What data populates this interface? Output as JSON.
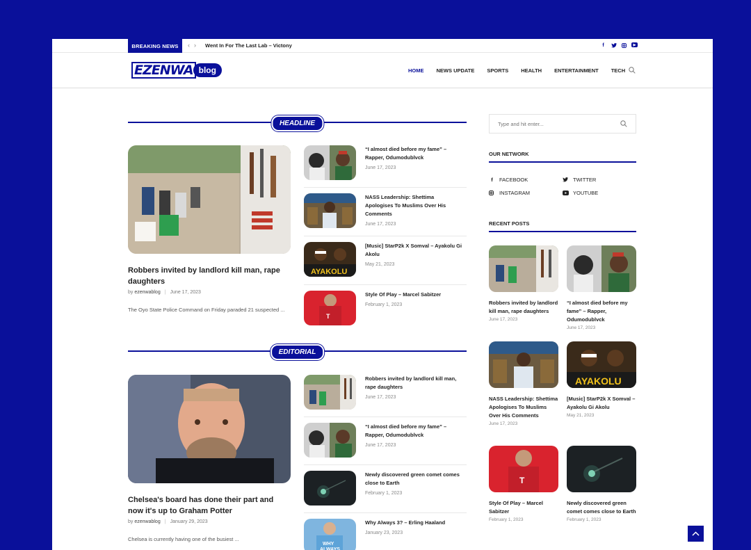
{
  "topbar": {
    "breaking_label": "BREAKING NEWS",
    "ticker_text": "Went In For The Last Lab – Victony",
    "social_icons": [
      "facebook-icon",
      "twitter-icon",
      "instagram-icon",
      "youtube-icon"
    ]
  },
  "header": {
    "logo_text": "EZENWA",
    "logo_suffix": "blog",
    "nav": [
      "HOME",
      "NEWS UPDATE",
      "SPORTS",
      "HEALTH",
      "ENTERTAINMENT",
      "TECH"
    ],
    "active_nav": "HOME"
  },
  "headline": {
    "section_label": "HEADLINE",
    "main": {
      "title": "Robbers invited by landlord kill man, rape daughters",
      "author_prefix": "by",
      "author": "ezenwablog",
      "date": "June 17, 2023",
      "excerpt": "The Oyo State Police Command on Friday paraded 21 suspected ..."
    },
    "list": [
      {
        "title": "“I almost died before my fame” – Rapper, Odumodublvck",
        "date": "June 17, 2023"
      },
      {
        "title": "NASS Leadership: Shettima Apologises To Muslims Over His Comments",
        "date": "June 17, 2023"
      },
      {
        "title": "[Music] StarP2k X Somval – Ayakolu Gi Akolu",
        "date": "May 21, 2023"
      },
      {
        "title": "Style Of Play – Marcel Sabitzer",
        "date": "February 1, 2023"
      }
    ]
  },
  "editorial": {
    "section_label": "EDITORIAL",
    "main": {
      "title": "Chelsea's board has done their part and now it's up to Graham Potter",
      "author_prefix": "by",
      "author": "ezenwablog",
      "date": "January 29, 2023",
      "excerpt": "Chelsea is currently having one of the busiest ..."
    },
    "list": [
      {
        "title": "Robbers invited by landlord kill man, rape daughters",
        "date": "June 17, 2023"
      },
      {
        "title": "“I almost died before my fame” – Rapper, Odumodublvck",
        "date": "June 17, 2023"
      },
      {
        "title": "Newly discovered green comet comes close to Earth",
        "date": "February 1, 2023"
      },
      {
        "title": "Why Always 3? – Erling Haaland",
        "date": "January 23, 2023"
      }
    ]
  },
  "sidebar": {
    "search_placeholder": "Type and hit enter...",
    "network_title": "OUR NETWORK",
    "network": [
      {
        "label": "FACEBOOK",
        "icon": "facebook-icon"
      },
      {
        "label": "TWITTER",
        "icon": "twitter-icon"
      },
      {
        "label": "INSTAGRAM",
        "icon": "instagram-icon"
      },
      {
        "label": "YOUTUBE",
        "icon": "youtube-icon"
      }
    ],
    "recent_title": "RECENT POSTS",
    "recent": [
      {
        "title": "Robbers invited by landlord kill man, rape daughters",
        "date": "June 17, 2023"
      },
      {
        "title": "“I almost died before my fame” – Rapper, Odumodublvck",
        "date": "June 17, 2023"
      },
      {
        "title": "NASS Leadership: Shettima Apologises To Muslims Over His Comments",
        "date": "June 17, 2023"
      },
      {
        "title": "[Music] StarP2k X Somval – Ayakolu Gi Akolu",
        "date": "May 21, 2023"
      },
      {
        "title": "Style Of Play – Marcel Sabitzer",
        "date": "February 1, 2023"
      },
      {
        "title": "Newly discovered green comet comes close to Earth",
        "date": "February 1, 2023"
      }
    ]
  },
  "colors": {
    "brand": "#0a109a",
    "text": "#222222",
    "meta": "#888888"
  }
}
